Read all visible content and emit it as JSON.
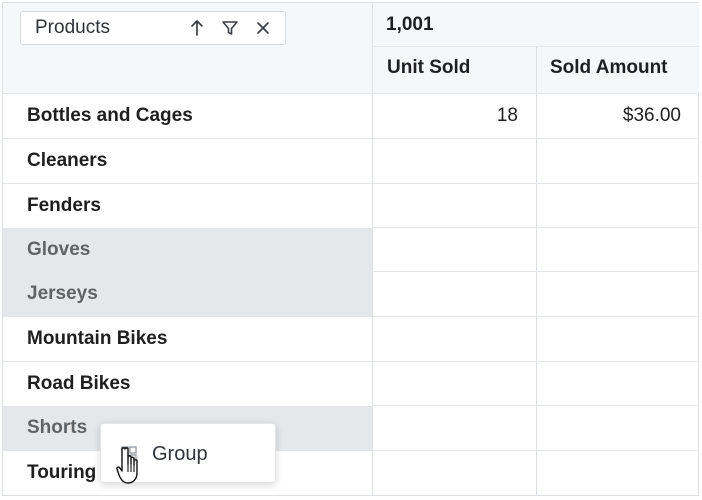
{
  "pivot": {
    "row_field": {
      "label": "Products",
      "sort_icon": "arrow-up-icon",
      "filter_icon": "filter-icon",
      "remove_icon": "close-icon"
    },
    "column_total": "1,001",
    "measures": [
      "Unit Sold",
      "Sold Amount"
    ],
    "rows": [
      {
        "label": "Bottles and Cages",
        "selected": false,
        "unit_sold": "18",
        "sold_amount": "$36.00"
      },
      {
        "label": "Cleaners",
        "selected": false,
        "unit_sold": "",
        "sold_amount": ""
      },
      {
        "label": "Fenders",
        "selected": false,
        "unit_sold": "",
        "sold_amount": ""
      },
      {
        "label": "Gloves",
        "selected": true,
        "unit_sold": "",
        "sold_amount": ""
      },
      {
        "label": "Jerseys",
        "selected": true,
        "unit_sold": "",
        "sold_amount": ""
      },
      {
        "label": "Mountain Bikes",
        "selected": false,
        "unit_sold": "",
        "sold_amount": ""
      },
      {
        "label": "Road Bikes",
        "selected": false,
        "unit_sold": "",
        "sold_amount": ""
      },
      {
        "label": "Shorts",
        "selected": true,
        "unit_sold": "",
        "sold_amount": ""
      },
      {
        "label": "Touring",
        "selected": false,
        "unit_sold": "",
        "sold_amount": ""
      }
    ]
  },
  "context_menu": {
    "items": [
      {
        "label": "Group",
        "icon": "group-icon"
      }
    ]
  },
  "colors": {
    "header_bg": "#f6f7f9",
    "selected_row_bg": "#e6e7ea",
    "grid_line": "#dcdfe4"
  }
}
